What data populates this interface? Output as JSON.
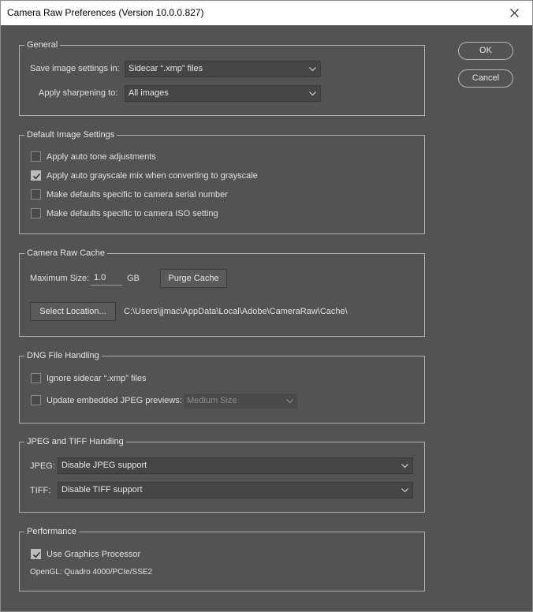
{
  "window": {
    "title": "Camera Raw Preferences  (Version 10.0.0.827)",
    "close_glyph": "✕"
  },
  "buttons": {
    "ok": "OK",
    "cancel": "Cancel"
  },
  "general": {
    "legend": "General",
    "save_label": "Save image settings in:",
    "save_value": "Sidecar “.xmp” files",
    "sharpen_label": "Apply sharpening to:",
    "sharpen_value": "All images"
  },
  "default_image": {
    "legend": "Default Image Settings",
    "options": [
      {
        "label": "Apply auto tone adjustments",
        "checked": false
      },
      {
        "label": "Apply auto grayscale mix when converting to grayscale",
        "checked": true
      },
      {
        "label": "Make defaults specific to camera serial number",
        "checked": false
      },
      {
        "label": "Make defaults specific to camera ISO setting",
        "checked": false
      }
    ]
  },
  "cache": {
    "legend": "Camera Raw Cache",
    "max_size_label": "Maximum Size:",
    "max_size_value": "1.0",
    "unit": "GB",
    "purge_label": "Purge Cache",
    "select_location_label": "Select Location...",
    "path": "C:\\Users\\jjmac\\AppData\\Local\\Adobe\\CameraRaw\\Cache\\"
  },
  "dng": {
    "legend": "DNG File Handling",
    "ignore_sidecar": {
      "label": "Ignore sidecar “.xmp” files",
      "checked": false
    },
    "update_previews": {
      "label": "Update embedded JPEG previews:",
      "checked": false
    },
    "preview_size": "Medium Size"
  },
  "jpeg_tiff": {
    "legend": "JPEG and TIFF Handling",
    "jpeg_label": "JPEG:",
    "jpeg_value": "Disable JPEG support",
    "tiff_label": "TIFF:",
    "tiff_value": "Disable TIFF support"
  },
  "performance": {
    "legend": "Performance",
    "gpu": {
      "label": "Use Graphics Processor",
      "checked": true
    },
    "opengl": "OpenGL: Quadro 4000/PCIe/SSE2"
  },
  "colors": {
    "background": "#535353",
    "border": "#b0b0b0",
    "text": "#e0e0e0"
  }
}
